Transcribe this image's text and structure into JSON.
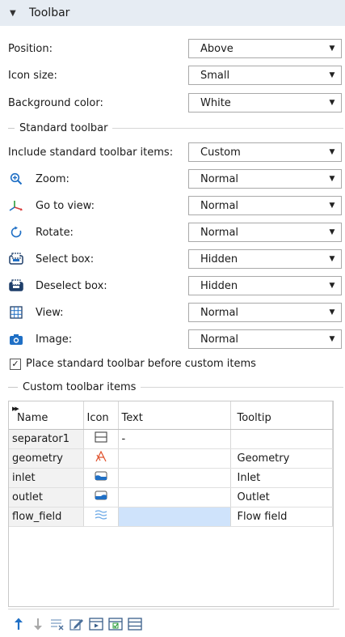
{
  "header": {
    "title": "Toolbar"
  },
  "settings": {
    "position": {
      "label": "Position:",
      "value": "Above"
    },
    "icon_size": {
      "label": "Icon size:",
      "value": "Small"
    },
    "background_color": {
      "label": "Background color:",
      "value": "White"
    }
  },
  "standard_section": {
    "title": "Standard toolbar"
  },
  "standard": {
    "include": {
      "label": "Include standard toolbar items:",
      "value": "Custom"
    },
    "zoom": {
      "label": "Zoom:",
      "value": "Normal",
      "icon": "zoom-icon"
    },
    "go_to_view": {
      "label": "Go to view:",
      "value": "Normal",
      "icon": "axes-icon"
    },
    "rotate": {
      "label": "Rotate:",
      "value": "Normal",
      "icon": "rotate-icon"
    },
    "select_box": {
      "label": "Select box:",
      "value": "Hidden",
      "icon": "select-box-icon"
    },
    "deselect_box": {
      "label": "Deselect box:",
      "value": "Hidden",
      "icon": "deselect-box-icon"
    },
    "view": {
      "label": "View:",
      "value": "Normal",
      "icon": "view-grid-icon"
    },
    "image": {
      "label": "Image:",
      "value": "Normal",
      "icon": "camera-icon"
    }
  },
  "place_before": {
    "label": "Place standard toolbar before custom items",
    "checked": true
  },
  "custom_section": {
    "title": "Custom toolbar items"
  },
  "table": {
    "headers": {
      "name": "Name",
      "icon": "Icon",
      "text": "Text",
      "tooltip": "Tooltip"
    },
    "rows": [
      {
        "name": "separator1",
        "icon": "separator-icon",
        "text": "-",
        "tooltip": ""
      },
      {
        "name": "geometry",
        "icon": "geometry-icon",
        "text": "",
        "tooltip": "Geometry"
      },
      {
        "name": "inlet",
        "icon": "inlet-icon",
        "text": "",
        "tooltip": "Inlet"
      },
      {
        "name": "outlet",
        "icon": "outlet-icon",
        "text": "",
        "tooltip": "Outlet"
      },
      {
        "name": "flow_field",
        "icon": "flow-field-icon",
        "text": "",
        "tooltip": "Flow field"
      }
    ]
  },
  "bottom_toolbar": [
    "move-up-icon",
    "move-down-icon",
    "delete-list-icon",
    "edit-icon",
    "add-action-icon",
    "add-checkbox-icon",
    "add-separator-icon"
  ],
  "colors": {
    "header_bg": "#e6ecf3",
    "accent_blue": "#1f6fc5",
    "selected_cell": "#cfe3fb"
  }
}
